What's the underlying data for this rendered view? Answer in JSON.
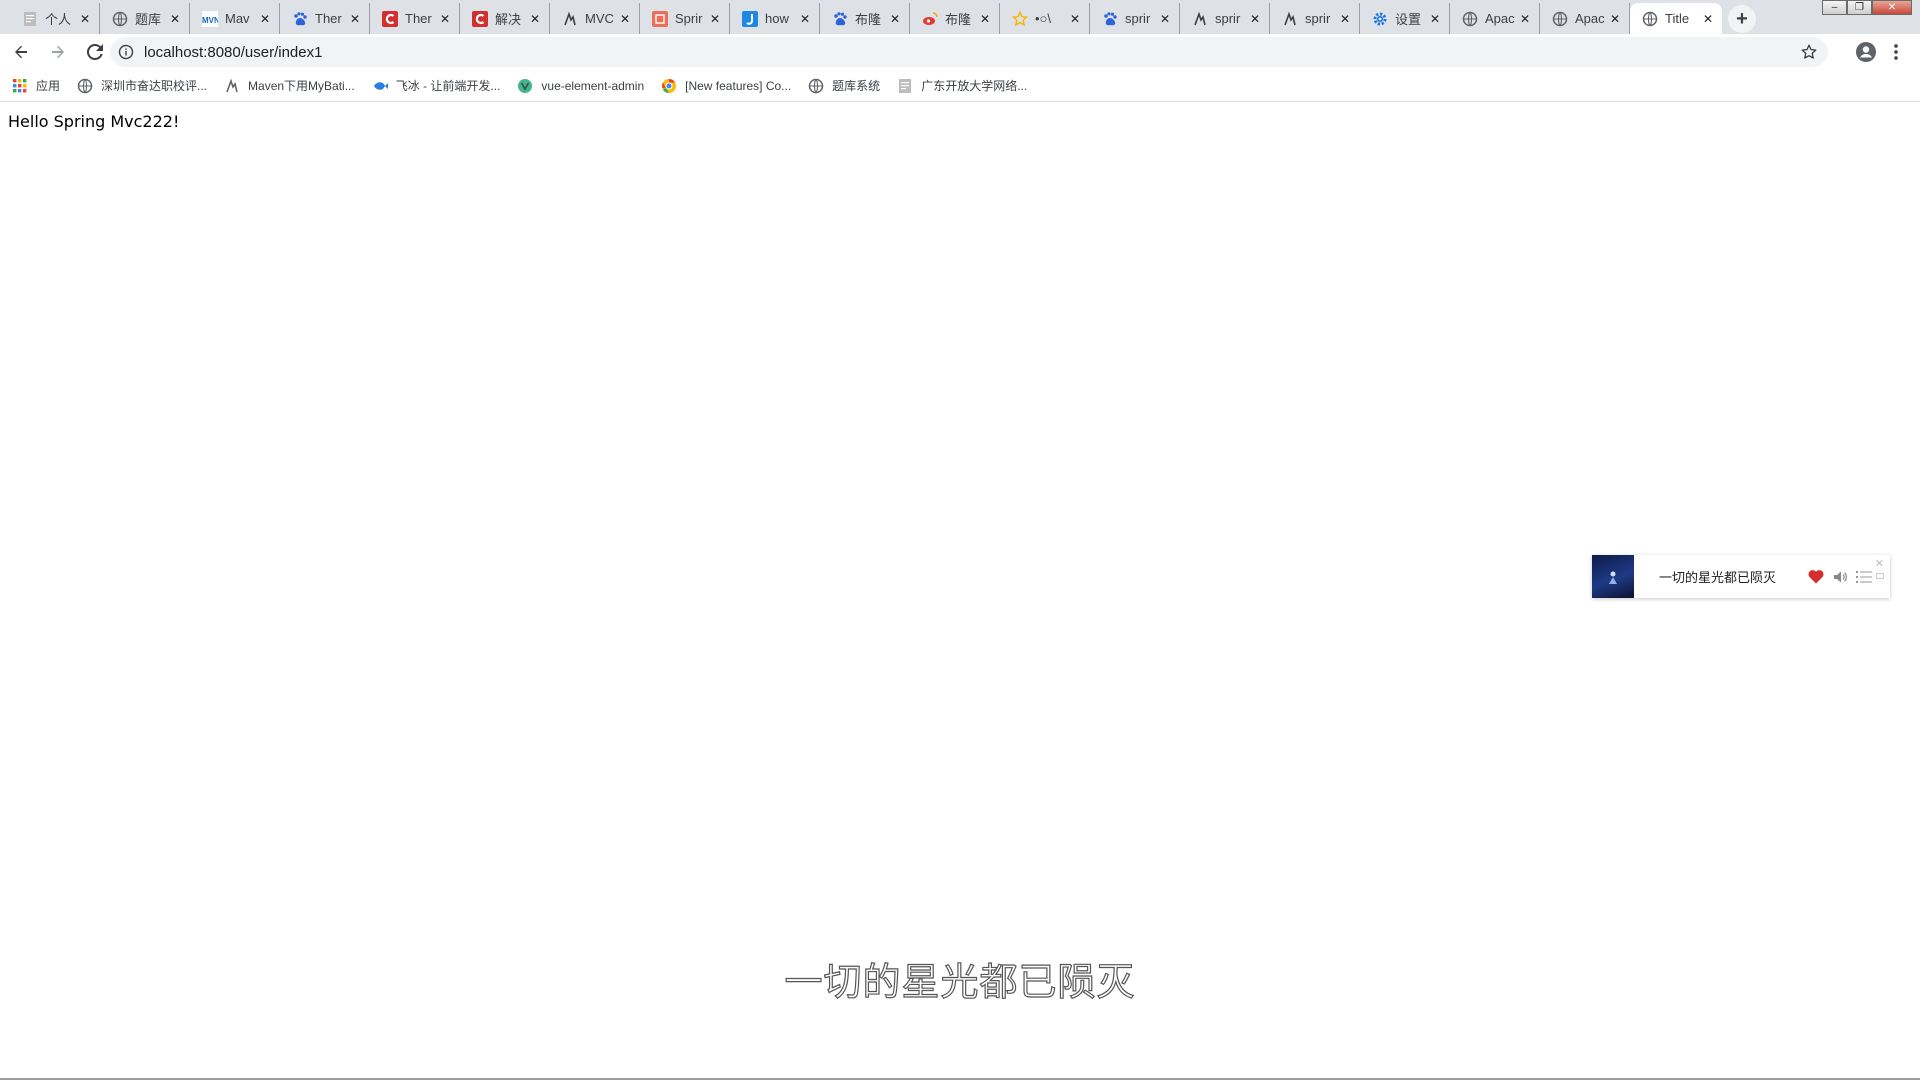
{
  "browser": {
    "tabs": [
      {
        "title": "个人",
        "icon": "doc-icon",
        "color": "#7a7a7a"
      },
      {
        "title": "题库",
        "icon": "globe-icon",
        "color": "#5f6368"
      },
      {
        "title": "Mav",
        "icon": "mvn-icon",
        "color": "#1565c0"
      },
      {
        "title": "Ther",
        "icon": "baidu-paw-icon",
        "color": "#2d64d8"
      },
      {
        "title": "Ther",
        "icon": "csdn-icon",
        "color": "#d32f2f"
      },
      {
        "title": "解决",
        "icon": "csdn-icon",
        "color": "#d32f2f"
      },
      {
        "title": "MVC",
        "icon": "yuque-icon",
        "color": "#3c4043"
      },
      {
        "title": "Sprir",
        "icon": "jianshu-icon",
        "color": "#ea6f5a"
      },
      {
        "title": "how",
        "icon": "j-icon",
        "color": "#1e88e5"
      },
      {
        "title": "布隆",
        "icon": "baidu-paw-icon",
        "color": "#2d64d8"
      },
      {
        "title": "布隆",
        "icon": "weibo-icon",
        "color": "#e53935"
      },
      {
        "title": "•○\\",
        "icon": "star-icon",
        "color": "#f4b400"
      },
      {
        "title": "sprir",
        "icon": "baidu-paw-icon",
        "color": "#2d64d8"
      },
      {
        "title": "sprir",
        "icon": "yuque-icon",
        "color": "#3c4043"
      },
      {
        "title": "sprir",
        "icon": "yuque-icon",
        "color": "#3c4043"
      },
      {
        "title": "设置",
        "icon": "gear-icon",
        "color": "#1a73e8"
      },
      {
        "title": "Apac",
        "icon": "globe-icon",
        "color": "#5f6368"
      },
      {
        "title": "Apac",
        "icon": "globe-icon",
        "color": "#5f6368"
      },
      {
        "title": "Title",
        "icon": "globe-icon",
        "color": "#5f6368",
        "active": true
      }
    ],
    "url": "localhost:8080/user/index1",
    "bookmarks": [
      {
        "label": "应用",
        "icon": "apps-grid-icon"
      },
      {
        "label": "深圳市奋达职校评...",
        "icon": "globe-icon"
      },
      {
        "label": "Maven下用MyBati...",
        "icon": "yuque-icon"
      },
      {
        "label": "飞冰 - 让前端开发...",
        "icon": "fish-icon"
      },
      {
        "label": "vue-element-admin",
        "icon": "vue-icon"
      },
      {
        "label": "[New features] Co...",
        "icon": "chrome-icon"
      },
      {
        "label": "题库系统",
        "icon": "globe-icon"
      },
      {
        "label": "广东开放大学网络...",
        "icon": "doc-icon"
      }
    ]
  },
  "page": {
    "heading": "Hello Spring Mvc222!"
  },
  "player": {
    "song_title": "一切的星光都已陨灭",
    "liked": true,
    "accent": "#e53935"
  },
  "subtitle": {
    "text": "一切的星光都已陨灭"
  }
}
